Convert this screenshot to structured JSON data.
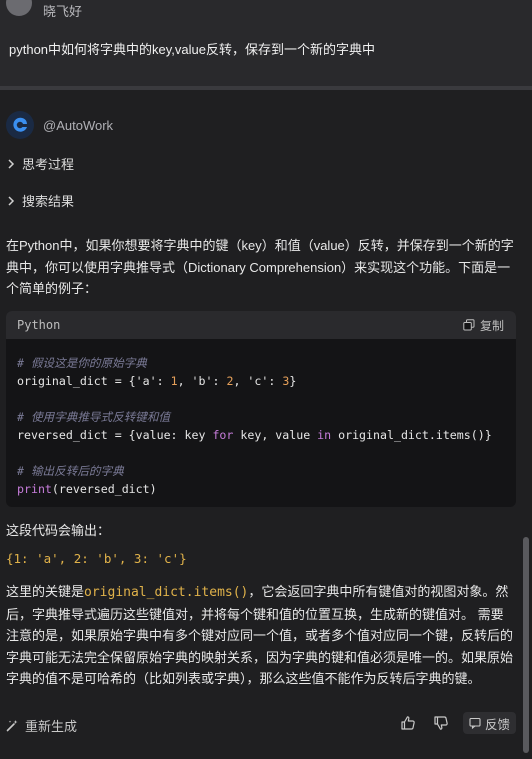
{
  "user": {
    "name": "晓飞好",
    "question": "python中如何将字典中的key,value反转，保存到一个新的字典中"
  },
  "bot": {
    "name": "@AutoWork",
    "logo_color": "#2f7fe8"
  },
  "sections": {
    "thinking": "思考过程",
    "search": "搜索结果"
  },
  "answer": {
    "intro": "在Python中，如果你想要将字典中的键（key）和值（value）反转，并保存到一个新的字典中，你可以使用字典推导式（Dictionary Comprehension）来实现这个功能。下面是一个简单的例子：",
    "output_label": "这段代码会输出：",
    "output_value": "{1: 'a', 2: 'b', 3: 'c'}",
    "explain_prefix": "这里的关键是",
    "explain_code": "original_dict.items()",
    "explain_suffix": "，它会返回字典中所有键值对的视图对象。然后，字典推导式遍历这些键值对，并将每个键和值的位置互换，生成新的键值对。 需要注意的是，如果原始字典中有多个键对应同一个值，或者多个值对应同一个键，反转后的字典可能无法完全保留原始字典的映射关系，因为字典的键和值必须是唯一的。如果原始字典的值不是可哈希的（比如列表或字典），那么这些值不能作为反转后字典的键。"
  },
  "code": {
    "language": "Python",
    "copy_label": "复制",
    "comment1": "# 假设这是你的原始字典",
    "line1_a": "original_dict = {",
    "line1_k1": "'a'",
    "line1_sep1": ": ",
    "line1_v1": "1",
    "line1_sep2": ", ",
    "line1_k2": "'b'",
    "line1_sep3": ": ",
    "line1_v2": "2",
    "line1_sep4": ", ",
    "line1_k3": "'c'",
    "line1_sep5": ": ",
    "line1_v3": "3",
    "line1_end": "}",
    "comment2": "# 使用字典推导式反转键和值",
    "line2_a": "reversed_dict = {value: key ",
    "line2_for": "for",
    "line2_b": " key, value ",
    "line2_in": "in",
    "line2_c": " original_dict.items()}",
    "comment3": "# 输出反转后的字典",
    "line3_print": "print",
    "line3_rest": "(reversed_dict)"
  },
  "footer": {
    "regenerate": "重新生成",
    "feedback": "反馈"
  }
}
